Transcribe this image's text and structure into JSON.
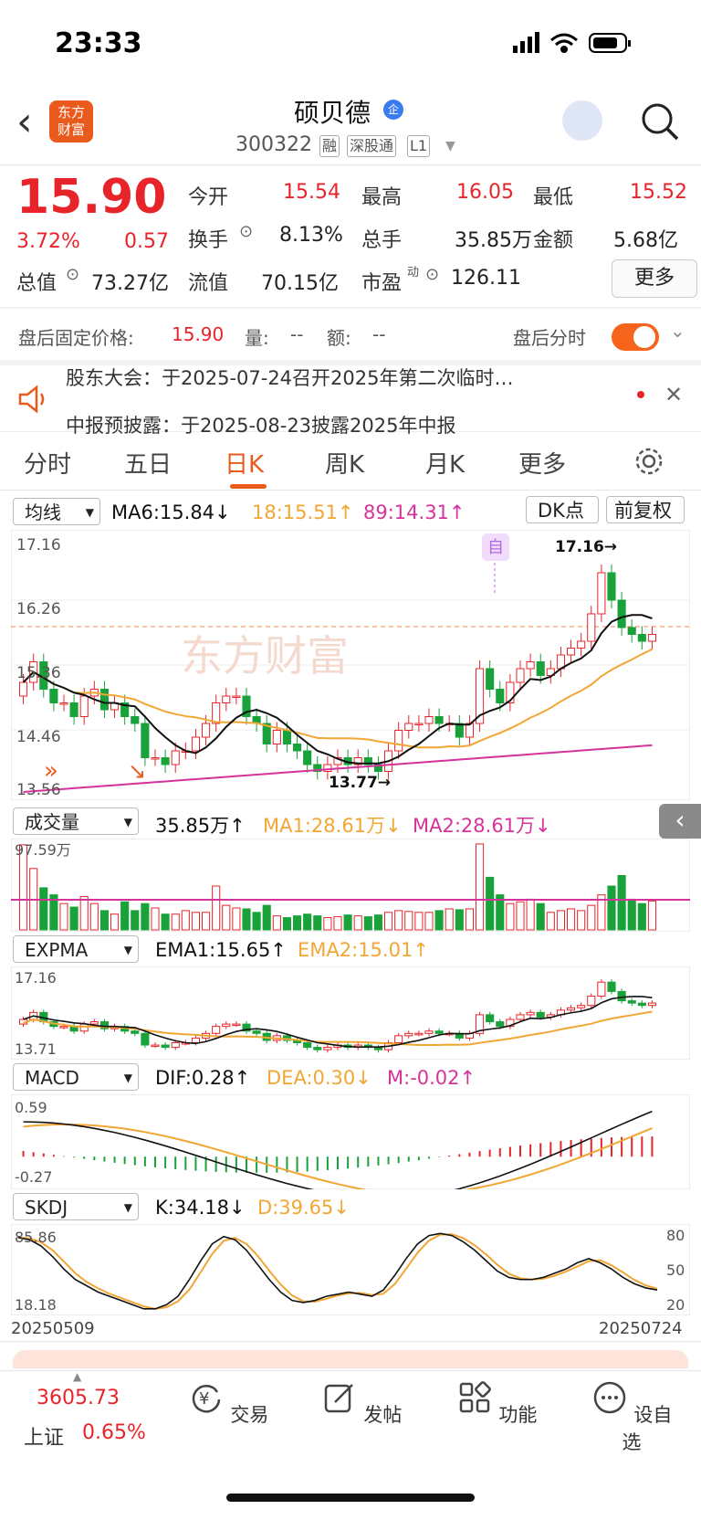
{
  "status_bar": {
    "time": "23:33"
  },
  "header": {
    "back_icon": "chevron-left-icon",
    "logo_text": "东方\n财富",
    "stock_name": "硕贝德",
    "qi_badge": "企",
    "code": "300322",
    "tags": [
      "融",
      "深股通",
      "L1"
    ],
    "robot_icon": "assistant-avatar-icon",
    "search_icon": "search-icon"
  },
  "quote": {
    "price": "15.90",
    "change_pct": "3.72%",
    "change": "0.57",
    "open_label": "今开",
    "open": "15.54",
    "high_label": "最高",
    "high": "16.05",
    "low_label": "最低",
    "low": "15.52",
    "turnover_label": "换手",
    "turnover": "8.13%",
    "volume_label": "总手",
    "volume": "35.85万",
    "amount_label": "金额",
    "amount": "5.68亿",
    "mktcap_label": "总值",
    "mktcap": "73.27亿",
    "float_label": "流值",
    "float": "70.15亿",
    "pe_label": "市盈",
    "pe_sup": "动",
    "pe": "126.11",
    "more": "更多"
  },
  "after_hours": {
    "label": "盘后固定价格:",
    "price": "15.90",
    "vol_label": "量:",
    "vol": "--",
    "amt_label": "额:",
    "amt": "--",
    "intraday_label": "盘后分时"
  },
  "notices": [
    "股东大会：于2025-07-24召开2025年第二次临时…",
    "中报预披露：于2025-08-23披露2025年中报"
  ],
  "tabs": [
    "分时",
    "五日",
    "日K",
    "周K",
    "月K",
    "更多"
  ],
  "active_tab": "日K",
  "kline": {
    "selector": "均线",
    "ma6": "MA6:15.84↓",
    "ma18": "18:15.51↑",
    "ma89": "89:14.31↑",
    "dk": "DK点",
    "adjust": "前复权",
    "axis_top": "17.16",
    "axis_2": "16.26",
    "axis_3": "15.36",
    "axis_4": "14.46",
    "axis_bottom": "13.56",
    "high_mark": "17.16→",
    "low_mark": "13.77→",
    "self_tag": "自",
    "watermark": "东方财富"
  },
  "volume": {
    "selector": "成交量",
    "val": "35.85万↑",
    "ma1": "MA1:28.61万↓",
    "ma2": "MA2:28.61万↓",
    "axis_top": "97.59万"
  },
  "expma": {
    "selector": "EXPMA",
    "ema1": "EMA1:15.65↑",
    "ema2": "EMA2:15.01↑",
    "axis_top": "17.16",
    "axis_bottom": "13.71"
  },
  "macd": {
    "selector": "MACD",
    "dif": "DIF:0.28↑",
    "dea": "DEA:0.30↓",
    "m": "M:-0.02↑",
    "axis_top": "0.59",
    "axis_bottom": "-0.27"
  },
  "skdj": {
    "selector": "SKDJ",
    "k": "K:34.18↓",
    "d": "D:39.65↓",
    "axis_top": "85.86",
    "axis_bottom": "18.18",
    "r80": "80",
    "r50": "50",
    "r20": "20"
  },
  "dates": {
    "start": "20250509",
    "end": "20250724"
  },
  "bottom": {
    "index_value": "3605.73",
    "index_name": "上证",
    "index_pct": "0.65%",
    "nav": [
      "交易",
      "发帖",
      "功能",
      "设自选"
    ]
  },
  "colors": {
    "up": "#e8242b",
    "down": "#1aa23a",
    "accent": "#ea5a1c",
    "ma6": "#111111",
    "ma18": "#f2a634",
    "ma89": "#d6339a"
  }
}
